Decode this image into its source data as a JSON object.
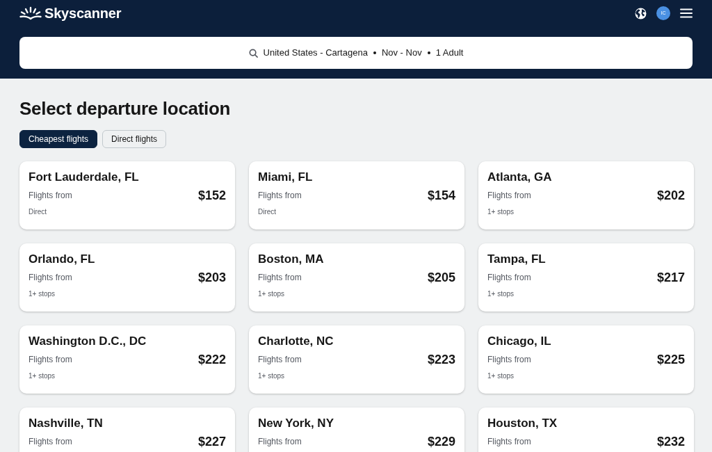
{
  "header": {
    "logo": "Skyscanner",
    "avatar": "IC"
  },
  "search": {
    "parts": [
      "United States - Cartagena",
      "Nov - Nov",
      "1 Adult"
    ]
  },
  "title": "Select departure location",
  "filters": [
    {
      "label": "Cheapest flights",
      "selected": true
    },
    {
      "label": "Direct flights",
      "selected": false
    }
  ],
  "destinations": [
    {
      "city": "Fort Lauderdale, FL",
      "label": "Flights from",
      "price": "$152",
      "stops": "Direct"
    },
    {
      "city": "Miami, FL",
      "label": "Flights from",
      "price": "$154",
      "stops": "Direct"
    },
    {
      "city": "Atlanta, GA",
      "label": "Flights from",
      "price": "$202",
      "stops": "1+ stops"
    },
    {
      "city": "Orlando, FL",
      "label": "Flights from",
      "price": "$203",
      "stops": "1+ stops"
    },
    {
      "city": "Boston, MA",
      "label": "Flights from",
      "price": "$205",
      "stops": "1+ stops"
    },
    {
      "city": "Tampa, FL",
      "label": "Flights from",
      "price": "$217",
      "stops": "1+ stops"
    },
    {
      "city": "Washington D.C., DC",
      "label": "Flights from",
      "price": "$222",
      "stops": "1+ stops"
    },
    {
      "city": "Charlotte, NC",
      "label": "Flights from",
      "price": "$223",
      "stops": "1+ stops"
    },
    {
      "city": "Chicago, IL",
      "label": "Flights from",
      "price": "$225",
      "stops": "1+ stops"
    },
    {
      "city": "Nashville, TN",
      "label": "Flights from",
      "price": "$227"
    },
    {
      "city": "New York, NY",
      "label": "Flights from",
      "price": "$229"
    },
    {
      "city": "Houston, TX",
      "label": "Flights from",
      "price": "$232"
    }
  ]
}
